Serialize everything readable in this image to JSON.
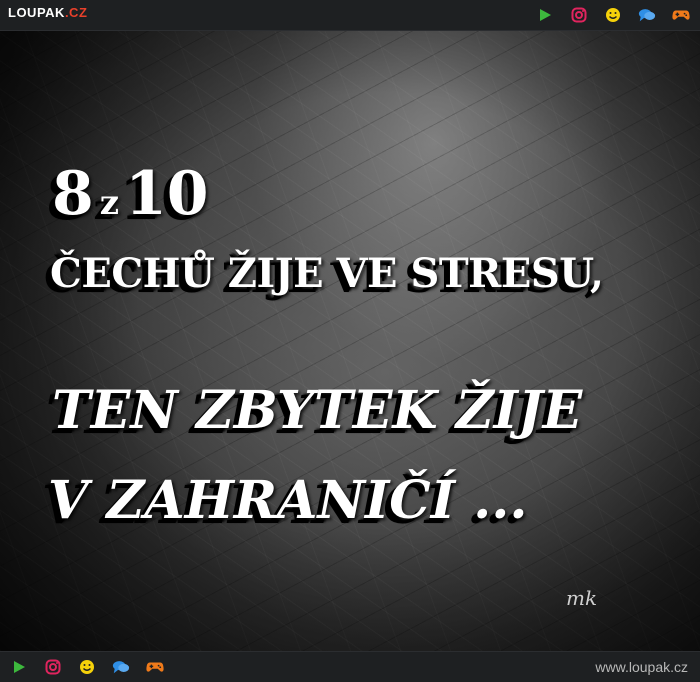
{
  "header": {
    "logo_main": "LOUPAK",
    "logo_tld": ".CZ",
    "icons": [
      "play-icon",
      "instagram-icon",
      "smiley-icon",
      "chat-icon",
      "gamepad-icon"
    ]
  },
  "poster": {
    "line1_big_a": "8",
    "line1_small": "z",
    "line1_big_b": "10",
    "line2": "ČECHŮ ŽIJE VE STRESU,",
    "line3": "TEN ZBYTEK ŽIJE",
    "line4": "V ZAHRANIČÍ ...",
    "signature": "mk"
  },
  "footer": {
    "url": "www.loupak.cz",
    "icons": [
      "play-icon",
      "instagram-icon",
      "smiley-icon",
      "chat-icon",
      "gamepad-icon"
    ]
  },
  "colors": {
    "bar_bg": "#1e2022",
    "logo_accent": "#e8402b",
    "play": "#3db83d",
    "instagram": "#e0245e",
    "smiley": "#f5d10a",
    "chat": "#2f8fe6",
    "gamepad": "#f07a1a"
  }
}
